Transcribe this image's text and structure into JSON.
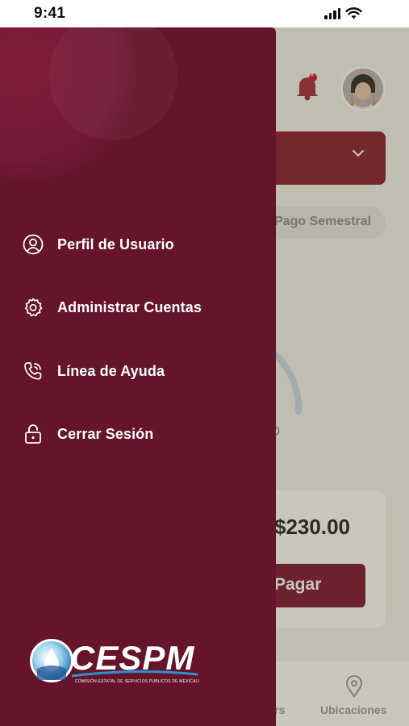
{
  "status_bar": {
    "time": "9:41"
  },
  "app": {
    "notification_count": "3",
    "plan_pill": "Pago Semestral",
    "ring_caption": "0",
    "amount": "$230.00",
    "pay_button": "Pagar",
    "nav_left_label": "rs",
    "nav_right_label": "Ubicaciones"
  },
  "drawer": {
    "items": [
      {
        "label": "Perfil de Usuario",
        "icon": "user-circle-icon"
      },
      {
        "label": "Administrar Cuentas",
        "icon": "gear-icon"
      },
      {
        "label": "Línea de Ayuda",
        "icon": "phone-call-icon"
      },
      {
        "label": "Cerrar Sesión",
        "icon": "unlock-icon"
      }
    ],
    "logo": {
      "name": "CESPM",
      "subtitle": "COMISIÓN ESTATAL DE SERVICIOS PÚBLICOS DE MEXICALI"
    }
  },
  "colors": {
    "drawer_bg": "#65142a",
    "brand_maroon": "#8a1c33",
    "overlay": "#e0d6c8"
  }
}
